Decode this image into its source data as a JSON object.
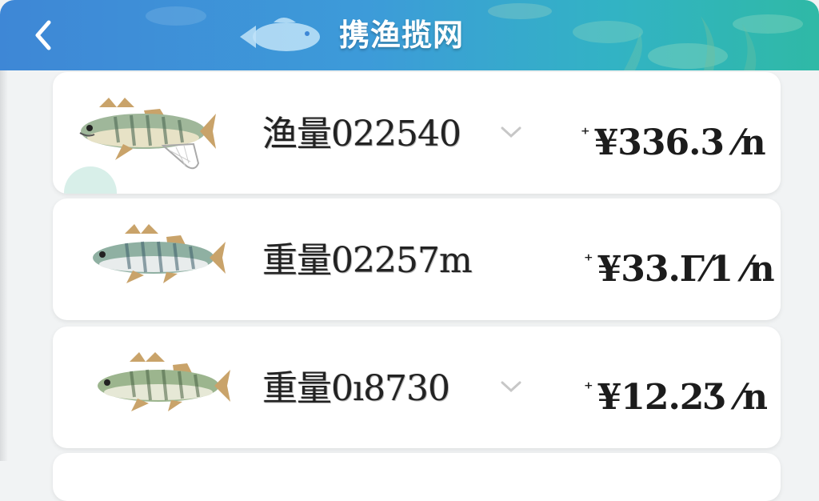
{
  "header": {
    "title": "携渔揽网",
    "back_icon": "chevron-left-icon"
  },
  "items": [
    {
      "label": "渔量022540",
      "price_mark": "⁺",
      "price": "¥336.3 ⁄n",
      "fish_icon": "perch-with-net-icon",
      "expand_icon": "chevron-down-icon"
    },
    {
      "label": "重量02257m",
      "price_mark": "⁺",
      "price": "¥33.Γ⁄1 ⁄n",
      "fish_icon": "perch-icon"
    },
    {
      "label": "重量0ı8730",
      "price_mark": "⁺",
      "price": "¥12.2Ʒ ⁄n",
      "fish_icon": "perch-icon",
      "expand_icon": "chevron-down-icon"
    }
  ],
  "colors": {
    "header_start": "#3e87d6",
    "header_end": "#2fb9a6",
    "card_bg": "#ffffff",
    "page_bg": "#f1f3f4"
  }
}
